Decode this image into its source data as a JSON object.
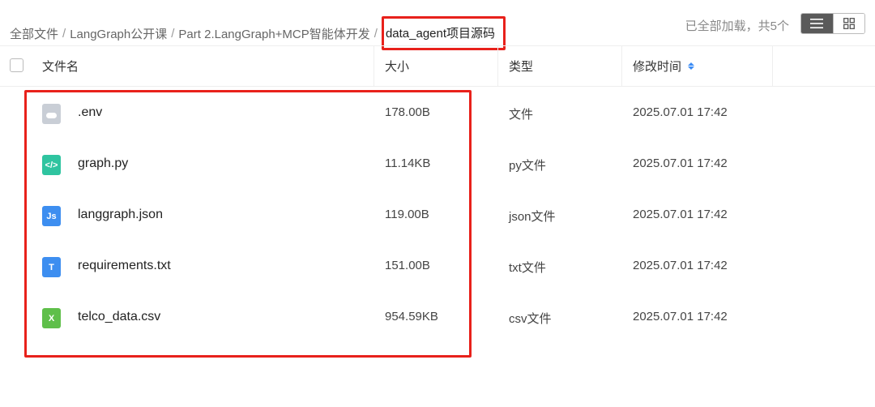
{
  "breadcrumb": {
    "items": [
      "全部文件",
      "LangGraph公开课",
      "Part 2.LangGraph+MCP智能体开发"
    ],
    "separator": "/",
    "current": "data_agent项目源码"
  },
  "load_status": "已全部加载，共5个",
  "view_modes": {
    "list": "list-view-icon",
    "grid": "grid-view-icon",
    "active": "list"
  },
  "table": {
    "headers": {
      "name": "文件名",
      "size": "大小",
      "type": "类型",
      "modified": "修改时间"
    },
    "rows": [
      {
        "name": ".env",
        "size": "178.00B",
        "type": "文件",
        "modified": "2025.07.01 17:42",
        "icon": "generic-file-icon",
        "icon_color": "#c9ced6",
        "icon_glyph": ""
      },
      {
        "name": "graph.py",
        "size": "11.14KB",
        "type": "py文件",
        "modified": "2025.07.01 17:42",
        "icon": "code-file-icon",
        "icon_color": "#2fc4a0",
        "icon_glyph": "</>"
      },
      {
        "name": "langgraph.json",
        "size": "119.00B",
        "type": "json文件",
        "modified": "2025.07.01 17:42",
        "icon": "js-file-icon",
        "icon_color": "#3d8ef0",
        "icon_glyph": "Js"
      },
      {
        "name": "requirements.txt",
        "size": "151.00B",
        "type": "txt文件",
        "modified": "2025.07.01 17:42",
        "icon": "text-file-icon",
        "icon_color": "#3d8ef0",
        "icon_glyph": "T"
      },
      {
        "name": "telco_data.csv",
        "size": "954.59KB",
        "type": "csv文件",
        "modified": "2025.07.01 17:42",
        "icon": "spreadsheet-file-icon",
        "icon_color": "#5fbf4a",
        "icon_glyph": "X"
      }
    ]
  },
  "colors": {
    "annotation": "#e8211b",
    "sort_accent": "#3b8cf5",
    "active_toggle": "#5a5a5a"
  }
}
